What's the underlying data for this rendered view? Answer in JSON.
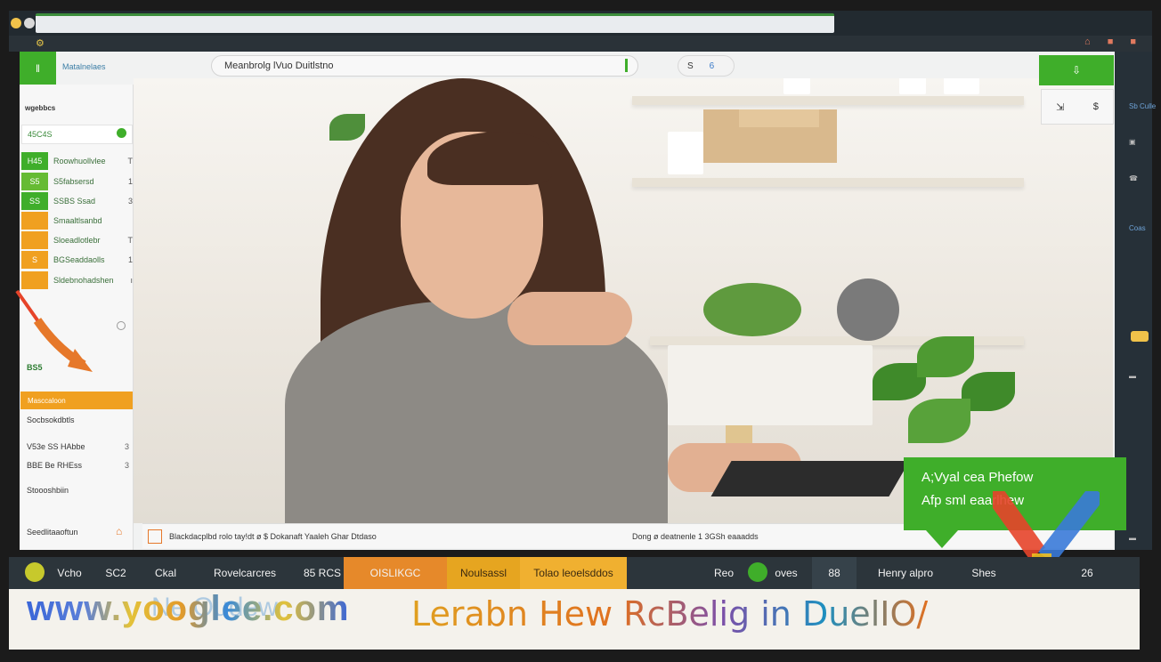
{
  "browser": {
    "top_icon_left": "⚙",
    "top_icons_right": "⌂ ■ ■"
  },
  "app": {
    "brand_chip": "ǁ",
    "brand_label": "Matalnelaes",
    "search": {
      "value": "Meanbrolg lVuo Duitlstno"
    },
    "chip_pill": {
      "a": "S",
      "b": "6"
    },
    "right_buttons": {
      "top": "⇩",
      "left": "⇲",
      "right": "$"
    }
  },
  "sidebar": {
    "header": "wgebbcs",
    "tag_label": "45C4S",
    "rows": [
      {
        "sq": "H45",
        "text": "Roowhuollvlee",
        "end": "T",
        "color": "#3fae2a"
      },
      {
        "sq": "S5",
        "text": "S5fabsersd",
        "end": "1",
        "color": "#66bb33"
      },
      {
        "sq": "SS",
        "text": "SSBS Ssad",
        "end": "3",
        "color": "#3fae2a"
      },
      {
        "sq": "",
        "text": "Smaaltlsanbd",
        "end": "",
        "color": "#f0a020"
      },
      {
        "sq": "",
        "text": "Sloeadlotlebr",
        "end": "T",
        "color": "#f0a020"
      },
      {
        "sq": "S",
        "text": "BGSeaddaolls",
        "end": "1",
        "color": "#f0a020"
      },
      {
        "sq": "",
        "text": "Sldebnohadshen",
        "end": "ı",
        "color": "#f0a020"
      }
    ],
    "green_small": "BS5",
    "orange_bar": "Masccaloon",
    "list_lead": "Socbsokdbtls",
    "rows2": [
      {
        "t": "V53e SS HAbbe",
        "e": "3"
      },
      {
        "t": "BBE Be RHEss",
        "e": "3"
      },
      {
        "t": "Stoooshbiin",
        "e": ""
      }
    ],
    "footer": "Seedlitaaoftun",
    "footer_icon": "⌂"
  },
  "rail": [
    "Sb Culle",
    "▣",
    "☎",
    "Coas",
    "▬",
    "▬"
  ],
  "info_bar": {
    "left": "Blackdacplbd rolo tay!dt ø $ Dokanaft Yaaleh Ghar Dtdaso",
    "right": "Dong ø deatnenle 1 3GSh eaaadds"
  },
  "callout": {
    "line1": "A;Vyal cea Phefow",
    "line2": "Afp sml eaarlhew"
  },
  "tabs": [
    {
      "label": "Vcho"
    },
    {
      "label": "SC2"
    },
    {
      "label": "Ckal"
    },
    {
      "label": "Rovelcarcres"
    },
    {
      "label": "85 RCS"
    },
    {
      "label": "OISLIKGC"
    },
    {
      "label": "Noulsassl"
    },
    {
      "label": "Tolao leoelsddos"
    },
    {
      "label": "Reo"
    },
    {
      "label": "oves"
    },
    {
      "label": "88"
    },
    {
      "label": "Henry alpro"
    },
    {
      "label": "Shes"
    },
    {
      "label": "26"
    }
  ],
  "banner": {
    "watermark": "www.yooglee.com",
    "shadow_text": "Ne Oudew",
    "headline": "Lerabn Hew RcBelig  in DuelIO/"
  },
  "colors": {
    "accent_green": "#3fae2a",
    "accent_orange": "#f0a020",
    "rail_dark": "#263038"
  }
}
